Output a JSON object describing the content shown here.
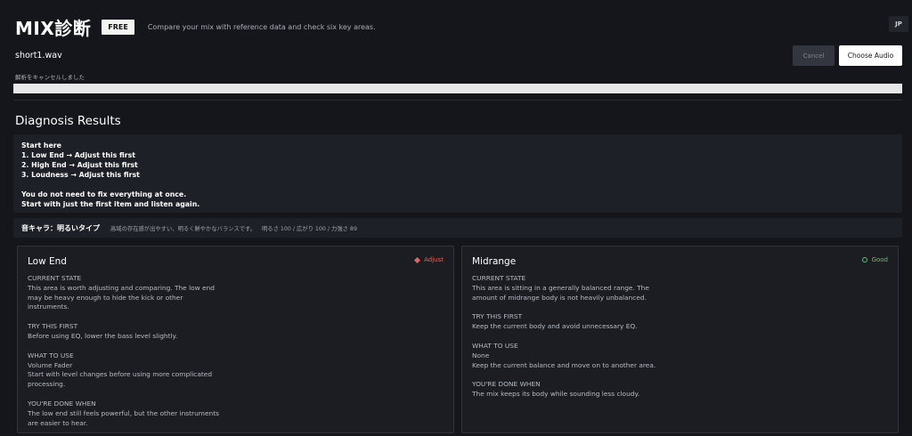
{
  "header": {
    "logo": "MIX診断",
    "badge": "FREE",
    "tagline": "Compare your mix with reference data and check six key areas.",
    "lang": "JP"
  },
  "file": {
    "name": "short1.wav",
    "cancel_label": "Cancel",
    "choose_label": "Choose Audio",
    "status": "解析をキャンセルしました",
    "progress_percent": 100
  },
  "results": {
    "title": "Diagnosis Results",
    "start_here": {
      "heading": "Start here",
      "items": [
        "1. Low End → Adjust this first",
        "2. High End → Adjust this first",
        "3. Loudness → Adjust this first"
      ],
      "note_1": "You do not need to fix everything at once.",
      "note_2": "Start with just the first item and listen again."
    },
    "character": {
      "title": "音キャラ：明るいタイプ",
      "description": "高域の存在感が出やすい、明るく鮮やかなバランスです。",
      "stats": "明るさ 100 / 広がり 100 / 力強さ 89"
    }
  },
  "cards": {
    "low_end": {
      "title": "Low End",
      "status": "Adjust",
      "status_color": "#e0655e",
      "current_heading": "CURRENT STATE",
      "current_text": "This area is worth adjusting and comparing. The low end may be heavy enough to hide the kick or other instruments.",
      "try_heading": "TRY THIS FIRST",
      "try_text": "Before using EQ, lower the bass level slightly.",
      "use_heading": "WHAT TO USE",
      "use_tool": "Volume Fader",
      "use_text": "Start with level changes before using more complicated processing.",
      "done_heading": "YOU'RE DONE WHEN",
      "done_text": "The low end still feels powerful, but the other instruments are easier to hear."
    },
    "midrange": {
      "title": "Midrange",
      "status": "Good",
      "status_color": "#5cc76a",
      "current_heading": "CURRENT STATE",
      "current_text": "This area is sitting in a generally balanced range. The amount of midrange body is not heavily unbalanced.",
      "try_heading": "TRY THIS FIRST",
      "try_text": "Keep the current body and avoid unnecessary EQ.",
      "use_heading": "WHAT TO USE",
      "use_tool": "None",
      "use_text": "Keep the current balance and move on to another area.",
      "done_heading": "YOU'RE DONE WHEN",
      "done_text": "The mix keeps its body while sounding less cloudy."
    }
  }
}
